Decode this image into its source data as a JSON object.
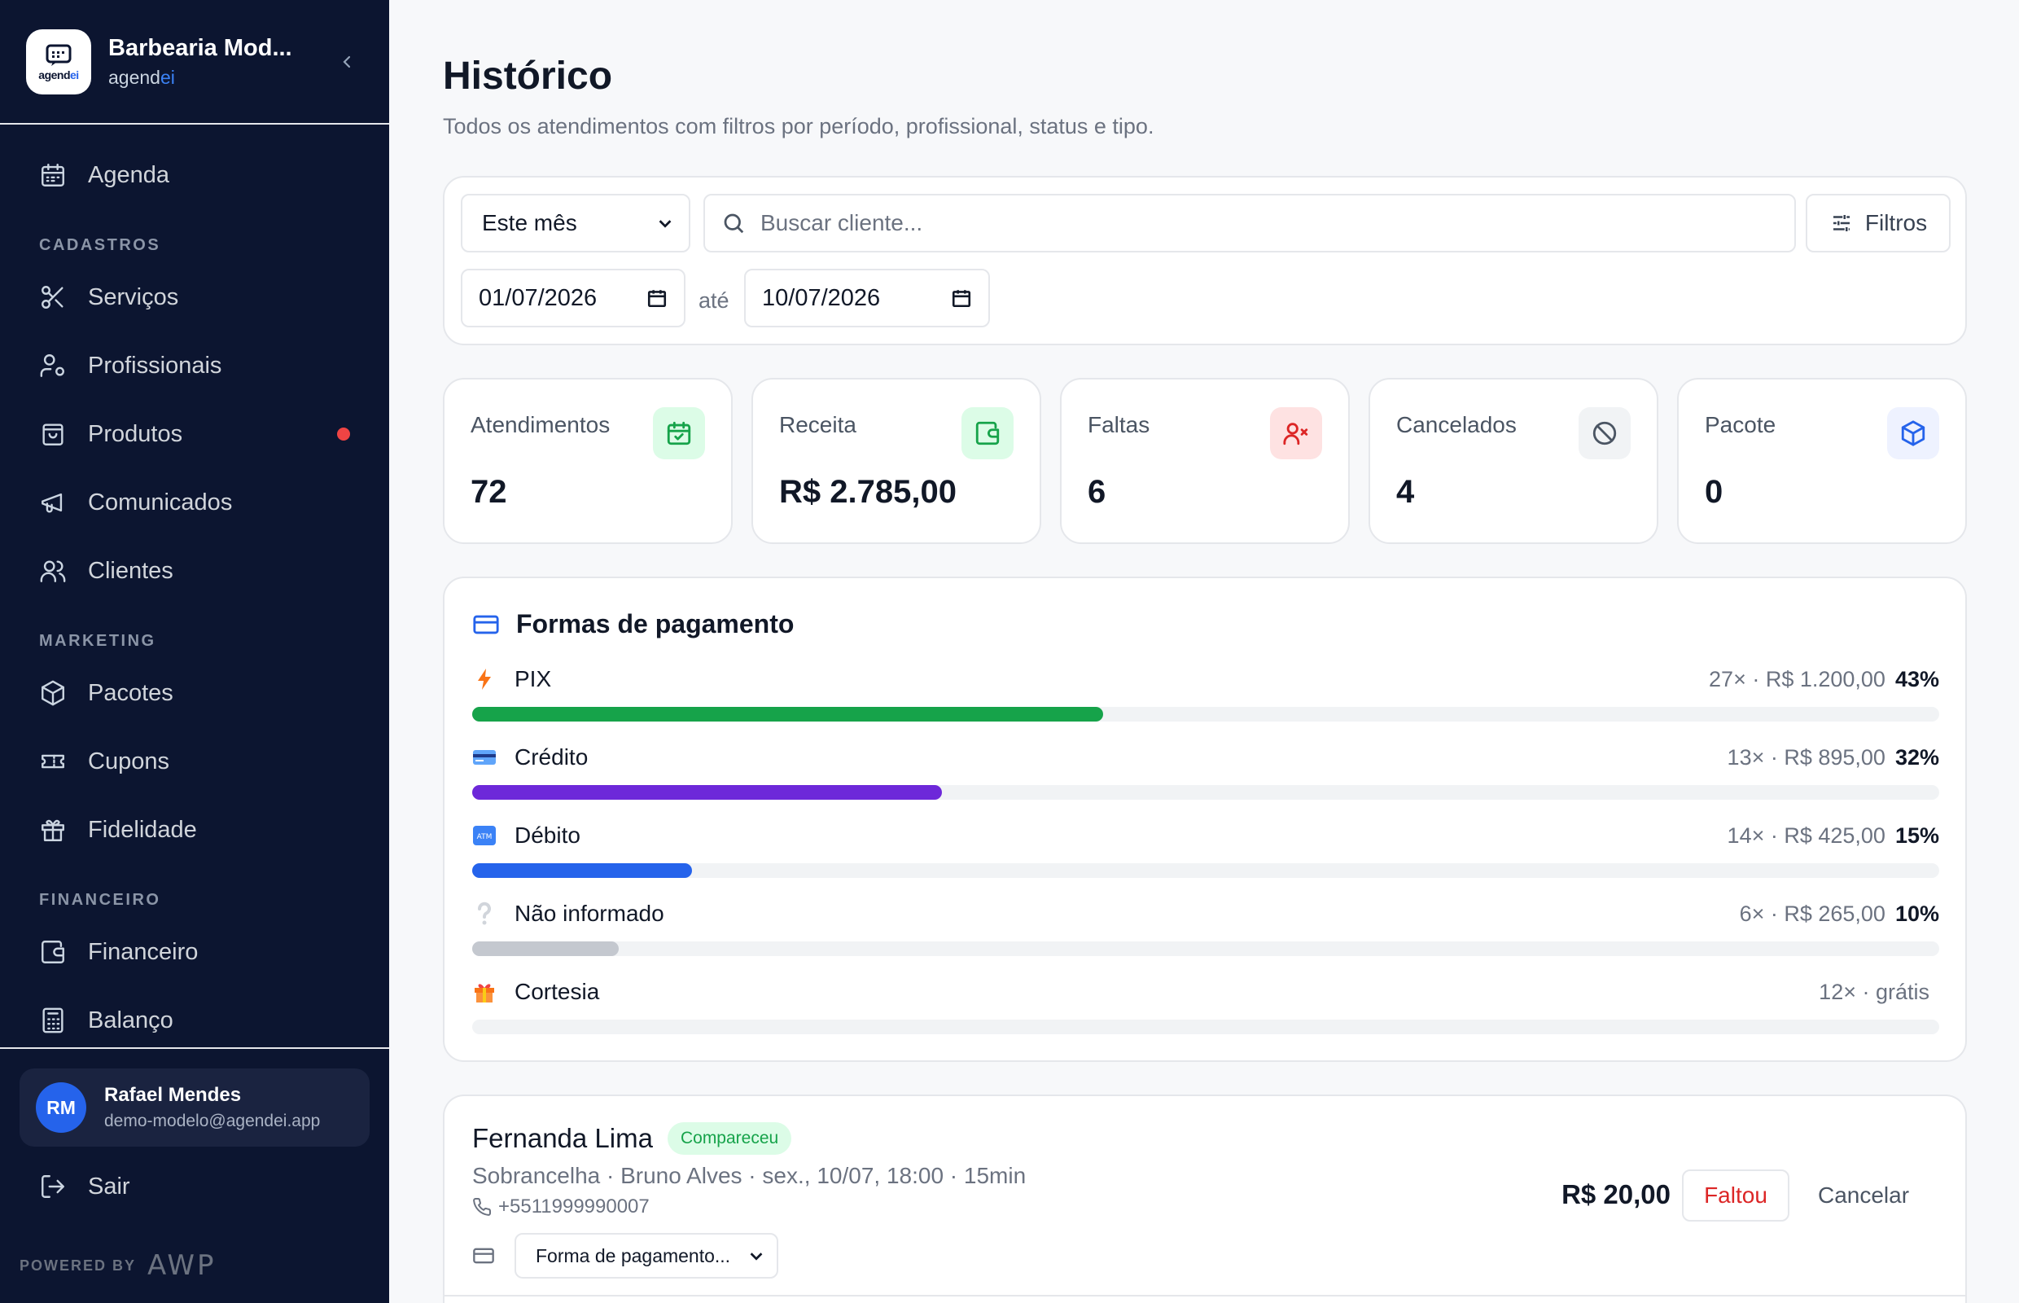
{
  "brand": {
    "name": "Barbearia Mod...",
    "sub_prefix": "agend",
    "sub_suffix": "ei",
    "logo_prefix": "agend",
    "logo_suffix": "ei"
  },
  "nav": {
    "agenda": "Agenda",
    "section_cadastros": "CADASTROS",
    "servicos": "Serviços",
    "profissionais": "Profissionais",
    "produtos": "Produtos",
    "comunicados": "Comunicados",
    "clientes": "Clientes",
    "section_marketing": "MARKETING",
    "pacotes": "Pacotes",
    "cupons": "Cupons",
    "fidelidade": "Fidelidade",
    "section_financeiro": "FINANCEIRO",
    "financeiro": "Financeiro",
    "balanco": "Balanço"
  },
  "user": {
    "initials": "RM",
    "name": "Rafael Mendes",
    "email": "demo-modelo@agendei.app"
  },
  "logout": "Sair",
  "powered": {
    "label": "POWERED BY",
    "logo": "AWP"
  },
  "page": {
    "title": "Histórico",
    "subtitle": "Todos os atendimentos com filtros por período, profissional, status e tipo."
  },
  "filters": {
    "period": "Este mês",
    "search_placeholder": "Buscar cliente...",
    "filters_label": "Filtros",
    "date_from": "01/07/2026",
    "date_sep": "até",
    "date_to": "10/07/2026"
  },
  "stats": [
    {
      "label": "Atendimentos",
      "value": "72",
      "icon": "calendar-check-icon",
      "color": "#16a34a",
      "bg": "#dcfce7"
    },
    {
      "label": "Receita",
      "value": "R$ 2.785,00",
      "icon": "wallet-icon",
      "color": "#16a34a",
      "bg": "#dcfce7"
    },
    {
      "label": "Faltas",
      "value": "6",
      "icon": "user-x-icon",
      "color": "#dc2626",
      "bg": "#fee2e2"
    },
    {
      "label": "Cancelados",
      "value": "4",
      "icon": "ban-icon",
      "color": "#4b5563",
      "bg": "#f1f3f5"
    },
    {
      "label": "Pacote",
      "value": "0",
      "icon": "package-icon",
      "color": "#2563eb",
      "bg": "#eef2ff"
    }
  ],
  "payments": {
    "title": "Formas de pagamento",
    "items": [
      {
        "name": "PIX",
        "stat": "27× · R$ 1.200,00",
        "pct_label": "43%",
        "pct": 43,
        "color": "#16a34a",
        "icon": "bolt-icon"
      },
      {
        "name": "Crédito",
        "stat": "13× · R$ 895,00",
        "pct_label": "32%",
        "pct": 32,
        "color": "#6d28d9",
        "icon": "credit-card-icon"
      },
      {
        "name": "Débito",
        "stat": "14× · R$ 425,00",
        "pct_label": "15%",
        "pct": 15,
        "color": "#2563eb",
        "icon": "atm-icon"
      },
      {
        "name": "Não informado",
        "stat": "6× · R$ 265,00",
        "pct_label": "10%",
        "pct": 10,
        "color": "#c4c8cf",
        "icon": "question-icon"
      },
      {
        "name": "Cortesia",
        "stat": "12× · grátis",
        "pct_label": "",
        "pct": 0,
        "color": "#c4c8cf",
        "icon": "gift-icon"
      }
    ]
  },
  "appointment": {
    "client": "Fernanda Lima",
    "status": "Compareceu",
    "info": "Sobrancelha · Bruno Alves · sex., 10/07, 18:00 · 15min",
    "phone": "+5511999990007",
    "payment_placeholder": "Forma de pagamento...",
    "price": "R$ 20,00",
    "faltou": "Faltou",
    "cancelar": "Cancelar"
  }
}
